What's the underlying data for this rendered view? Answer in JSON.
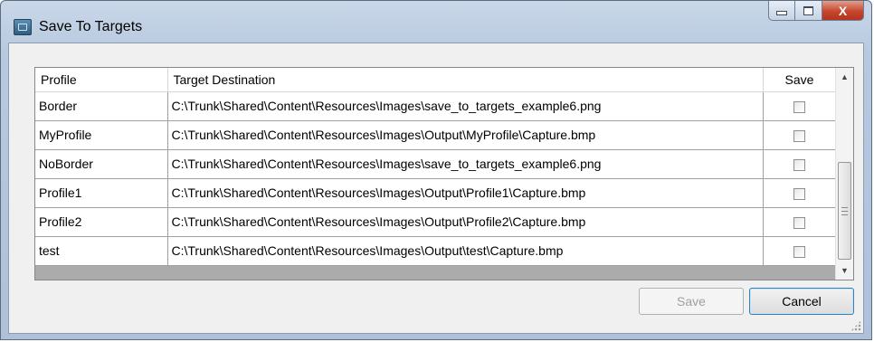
{
  "window": {
    "title": "Save To Targets",
    "icon": "app-window-icon",
    "controls": {
      "minimize_icon": "minimize-icon",
      "maximize_icon": "maximize-icon",
      "close_label": "X"
    }
  },
  "grid": {
    "columns": [
      "Profile",
      "Target Destination",
      "Save"
    ],
    "rows": [
      {
        "profile": "Border",
        "target": "C:\\Trunk\\Shared\\Content\\Resources\\Images\\save_to_targets_example6.png",
        "save": false
      },
      {
        "profile": "MyProfile",
        "target": "C:\\Trunk\\Shared\\Content\\Resources\\Images\\Output\\MyProfile\\Capture.bmp",
        "save": false
      },
      {
        "profile": "NoBorder",
        "target": "C:\\Trunk\\Shared\\Content\\Resources\\Images\\save_to_targets_example6.png",
        "save": false
      },
      {
        "profile": "Profile1",
        "target": "C:\\Trunk\\Shared\\Content\\Resources\\Images\\Output\\Profile1\\Capture.bmp",
        "save": false
      },
      {
        "profile": "Profile2",
        "target": "C:\\Trunk\\Shared\\Content\\Resources\\Images\\Output\\Profile2\\Capture.bmp",
        "save": false
      },
      {
        "profile": "test",
        "target": "C:\\Trunk\\Shared\\Content\\Resources\\Images\\Output\\test\\Capture.bmp",
        "save": false
      }
    ]
  },
  "buttons": {
    "save_label": "Save",
    "save_enabled": false,
    "cancel_label": "Cancel"
  },
  "scrollbar": {
    "up_glyph": "▲",
    "down_glyph": "▼"
  }
}
